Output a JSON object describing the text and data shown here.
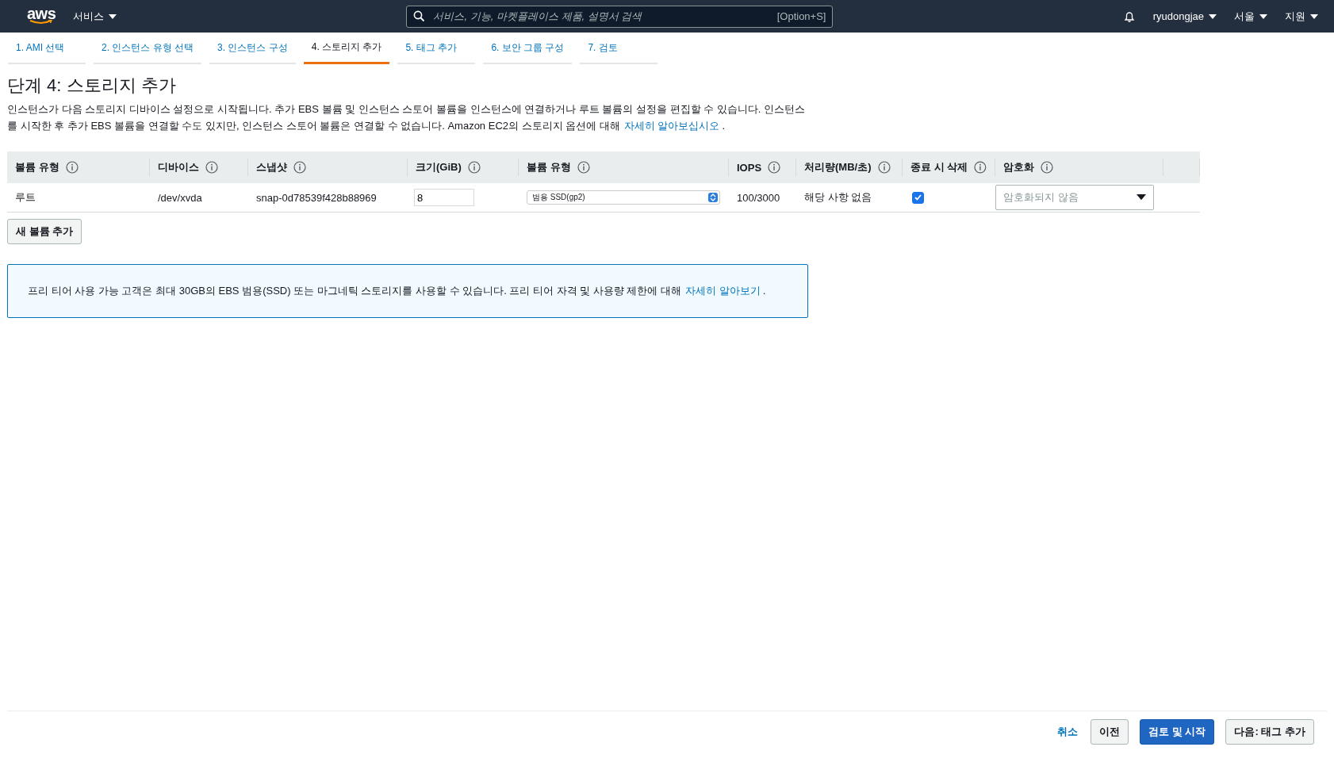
{
  "header": {
    "logo": "aws",
    "services": "서비스",
    "search_placeholder": "서비스, 기능, 마켓플레이스 제품, 설명서 검색",
    "shortcut": "[Option+S]",
    "user": "ryudongjae",
    "region": "서울",
    "support": "지원"
  },
  "steps": [
    {
      "label": "1. AMI 선택",
      "selected": false
    },
    {
      "label": "2. 인스턴스 유형 선택",
      "selected": false
    },
    {
      "label": "3. 인스턴스 구성",
      "selected": false
    },
    {
      "label": "4. 스토리지 추가",
      "selected": true
    },
    {
      "label": "5. 태그 추가",
      "selected": false
    },
    {
      "label": "6. 보안 그룹 구성",
      "selected": false
    },
    {
      "label": "7. 검토",
      "selected": false
    }
  ],
  "title": "단계 4: 스토리지 추가",
  "description": {
    "text": "인스턴스가 다음 스토리지 디바이스 설정으로 시작됩니다. 추가 EBS 볼륨 및 인스턴스 스토어 볼륨을 인스턴스에 연결하거나 루트 볼륨의 설정을 편집할 수 있습니다. 인스턴스를 시작한 후 추가 EBS 볼륨을 연결할 수도 있지만, 인스턴스 스토어 볼륨은 연결할 수 없습니다. Amazon EC2의 스토리지 옵션에 대해",
    "link": "자세히 알아보십시오",
    "after": "."
  },
  "table": {
    "columns": [
      "볼륨 유형",
      "디바이스",
      "스냅샷",
      "크기(GiB)",
      "볼륨 유형",
      "IOPS",
      "처리량(MB/초)",
      "종료 시 삭제",
      "암호화"
    ],
    "rows": [
      [
        {
          "kind": "text",
          "value": "루트"
        },
        {
          "kind": "text",
          "value": "/dev/xvda"
        },
        {
          "kind": "text",
          "value": "snap-0d78539f428b88969"
        },
        {
          "kind": "input",
          "value": "8"
        },
        {
          "kind": "select",
          "value": "범용 SSD(gp2)"
        },
        {
          "kind": "text",
          "value": "100/3000"
        },
        {
          "kind": "text",
          "value": "해당 사항 없음"
        },
        {
          "kind": "checkbox",
          "checked": true
        },
        {
          "kind": "dropdown",
          "placeholder": "암호화되지 않음"
        }
      ]
    ]
  },
  "add_volume": "새 볼륨 추가",
  "notice": {
    "text": "프리 티어 사용 가능 고객은 최대 30GB의 EBS 범용(SSD) 또는 마그네틱 스토리지를 사용할 수 있습니다. 프리 티어 자격 및 사용량 제한에 대해",
    "link": "자세히 알아보기",
    "after": "."
  },
  "footer": {
    "cancel": "취소",
    "previous": "이전",
    "review": "검토 및 시작",
    "next": "다음: 태그 추가"
  }
}
